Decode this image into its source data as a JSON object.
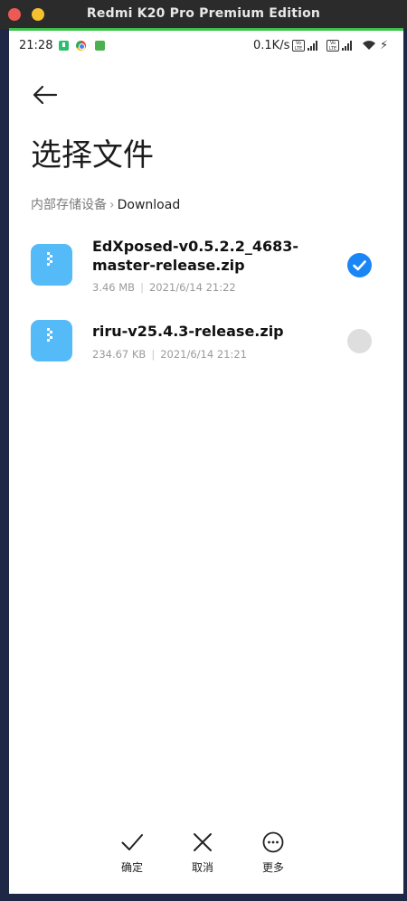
{
  "window": {
    "title": "Redmi K20 Pro Premium Edition",
    "accent_color": "#3cc24a"
  },
  "status_bar": {
    "time": "21:28",
    "net_speed": "0.1K/s",
    "volte_label": "Vo LTE"
  },
  "page": {
    "title": "选择文件",
    "breadcrumb": {
      "root": "内部存储设备",
      "separator": "›",
      "current": "Download"
    }
  },
  "files": [
    {
      "name": "EdXposed-v0.5.2.2_4683-master-release.zip",
      "size": "3.46 MB",
      "date": "2021/6/14 21:22",
      "selected": true
    },
    {
      "name": "riru-v25.4.3-release.zip",
      "size": "234.67 KB",
      "date": "2021/6/14 21:21",
      "selected": false
    }
  ],
  "meta_separator": "|",
  "actions": {
    "confirm": "确定",
    "cancel": "取消",
    "more": "更多"
  },
  "colors": {
    "file_icon": "#55baf8",
    "selected": "#1a86f5",
    "unselected": "#dedede"
  }
}
